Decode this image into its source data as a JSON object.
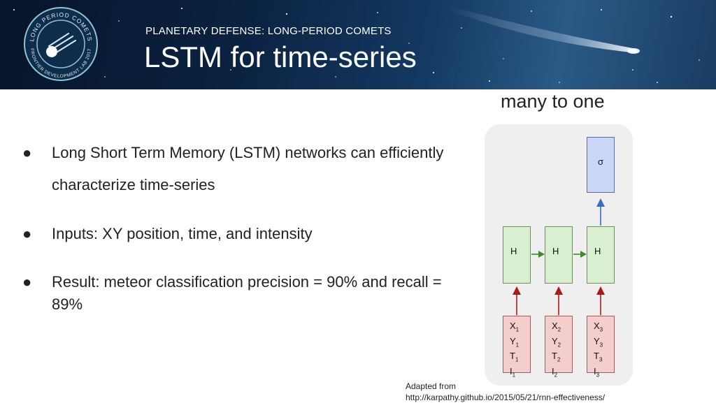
{
  "header": {
    "kicker": "PLANETARY DEFENSE: LONG-PERIOD COMETS",
    "title": "LSTM for time-series",
    "logo": {
      "top_text": "LONG PERIOD COMETS",
      "bottom_text": "FRONTIER DEVELOPMENT LAB 2017",
      "icon": "comet-icon"
    }
  },
  "bullets": [
    "Long Short Term Memory (LSTM) networks can efficiently characterize time-series",
    "Inputs: XY position, time, and intensity",
    "Result: meteor classification precision = 90% and recall = 89%"
  ],
  "bullet_symbol": "●",
  "diagram": {
    "title": "many to one",
    "output_label": "σ",
    "hidden_labels": [
      "H",
      "H",
      "H"
    ],
    "inputs": [
      {
        "x": "X",
        "y": "Y",
        "t": "T",
        "i": "I",
        "index": "1"
      },
      {
        "x": "X",
        "y": "Y",
        "t": "T",
        "i": "I",
        "index": "2"
      },
      {
        "x": "X",
        "y": "Y",
        "t": "T",
        "i": "I",
        "index": "3"
      }
    ],
    "colors": {
      "output": "#c9d7f8",
      "hidden": "#d9efd0",
      "input": "#f4cdcd",
      "up_arrow_input": "#b01818",
      "recurrent_arrow": "#3a8a2a",
      "output_arrow": "#2f6fd0"
    }
  },
  "credit": {
    "line1": "Adapted from",
    "line2": "http://karpathy.github.io/2015/05/21/rnn-effectiveness/"
  }
}
